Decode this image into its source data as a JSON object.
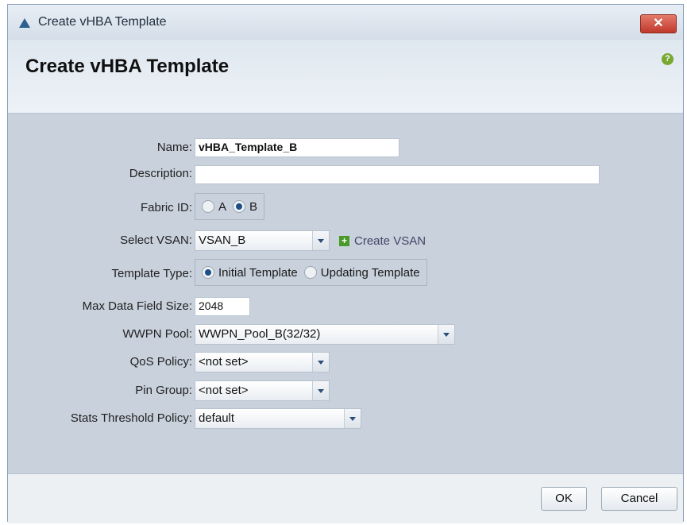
{
  "window": {
    "title": "Create vHBA Template",
    "close_label": "✕"
  },
  "header": {
    "title": "Create vHBA Template",
    "help_label": "?"
  },
  "form": {
    "name": {
      "label": "Name:",
      "value": "vHBA_Template_B"
    },
    "description": {
      "label": "Description:",
      "value": ""
    },
    "fabric_id": {
      "label": "Fabric ID:",
      "options": [
        "A",
        "B"
      ],
      "selected": "B"
    },
    "select_vsan": {
      "label": "Select VSAN:",
      "value": "VSAN_B",
      "create_link": "Create VSAN"
    },
    "template_type": {
      "label": "Template Type:",
      "options": [
        "Initial Template",
        "Updating Template"
      ],
      "selected": "Initial Template"
    },
    "max_data_field_size": {
      "label": "Max Data Field Size:",
      "value": "2048"
    },
    "wwpn_pool": {
      "label": "WWPN Pool:",
      "value": "WWPN_Pool_B(32/32)"
    },
    "qos_policy": {
      "label": "QoS Policy:",
      "value": "<not set>"
    },
    "pin_group": {
      "label": "Pin Group:",
      "value": "<not set>"
    },
    "stats_threshold_policy": {
      "label": "Stats Threshold Policy:",
      "value": "default"
    }
  },
  "footer": {
    "ok_label": "OK",
    "cancel_label": "Cancel"
  }
}
